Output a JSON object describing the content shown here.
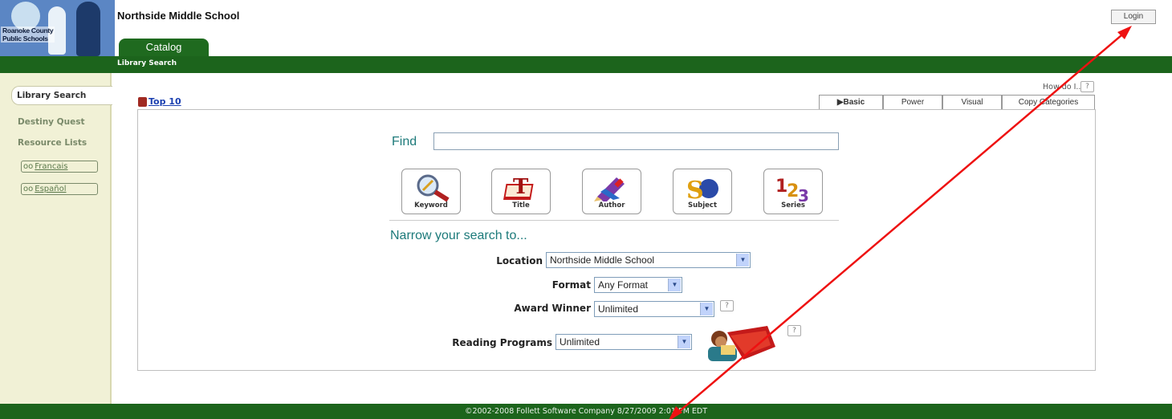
{
  "header": {
    "logo_text_line1": "Roanoke County",
    "logo_text_line2": "Public Schools",
    "school_name": "Northside Middle School",
    "catalog_tab": "Catalog",
    "login_label": "Login",
    "bar_label": "Library Search"
  },
  "sidebar": {
    "items": [
      {
        "label": "Library Search",
        "active": true
      },
      {
        "label": "Destiny Quest"
      },
      {
        "label": "Resource Lists"
      }
    ],
    "languages": [
      {
        "label": "Francais",
        "icon": "glasses-icon"
      },
      {
        "label": "Español",
        "icon": "glasses-icon"
      }
    ]
  },
  "main": {
    "how_do_i": "How do I...",
    "help_icon": "?",
    "top10_label": "Top 10",
    "tabs": [
      {
        "label": "▶Basic",
        "active": true
      },
      {
        "label": "Power"
      },
      {
        "label": "Visual"
      },
      {
        "label": "Copy Categories"
      }
    ],
    "find_label": "Find",
    "find_value": "",
    "search_buttons": [
      {
        "label": "Keyword",
        "icon": "magnifier-icon"
      },
      {
        "label": "Title",
        "icon": "book-title-icon"
      },
      {
        "label": "Author",
        "icon": "pencil-icon"
      },
      {
        "label": "Subject",
        "icon": "subject-icon"
      },
      {
        "label": "Series",
        "icon": "series-123-icon"
      }
    ],
    "narrow_label": "Narrow your search to...",
    "filters": {
      "location": {
        "label": "Location",
        "value": "Northside Middle School"
      },
      "format": {
        "label": "Format",
        "value": "Any Format"
      },
      "award": {
        "label": "Award Winner",
        "value": "Unlimited"
      },
      "reading": {
        "label": "Reading Programs",
        "value": "Unlimited"
      }
    }
  },
  "footer": {
    "text": "©2002-2008  Follett Software Company     8/27/2009 2:01 PM EDT"
  },
  "annotation": {
    "arrow_color": "#ee1111"
  }
}
